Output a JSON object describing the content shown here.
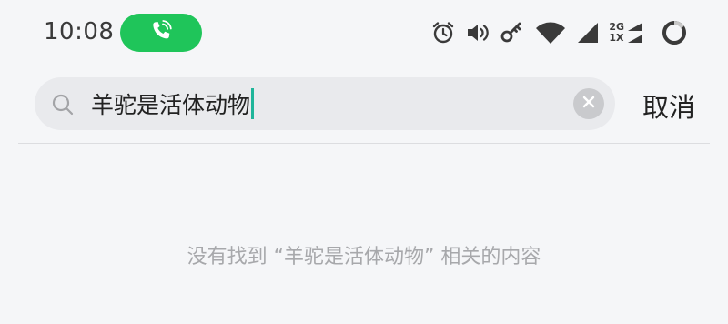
{
  "status_bar": {
    "time": "10:08",
    "network_top": "2G",
    "network_bottom": "1X",
    "icons": [
      "phone-call-icon",
      "alarm-icon",
      "volume-icon",
      "key-icon",
      "wifi-icon",
      "signal-icon",
      "signal-2-icon",
      "battery-ring-icon"
    ],
    "call_color": "#1fc55a"
  },
  "search": {
    "query": "羊驼是活体动物",
    "caret_color": "#1fb59a"
  },
  "cancel_label": "取消",
  "empty_state": {
    "message": "没有找到 “羊驼是活体动物” 相关的内容"
  }
}
